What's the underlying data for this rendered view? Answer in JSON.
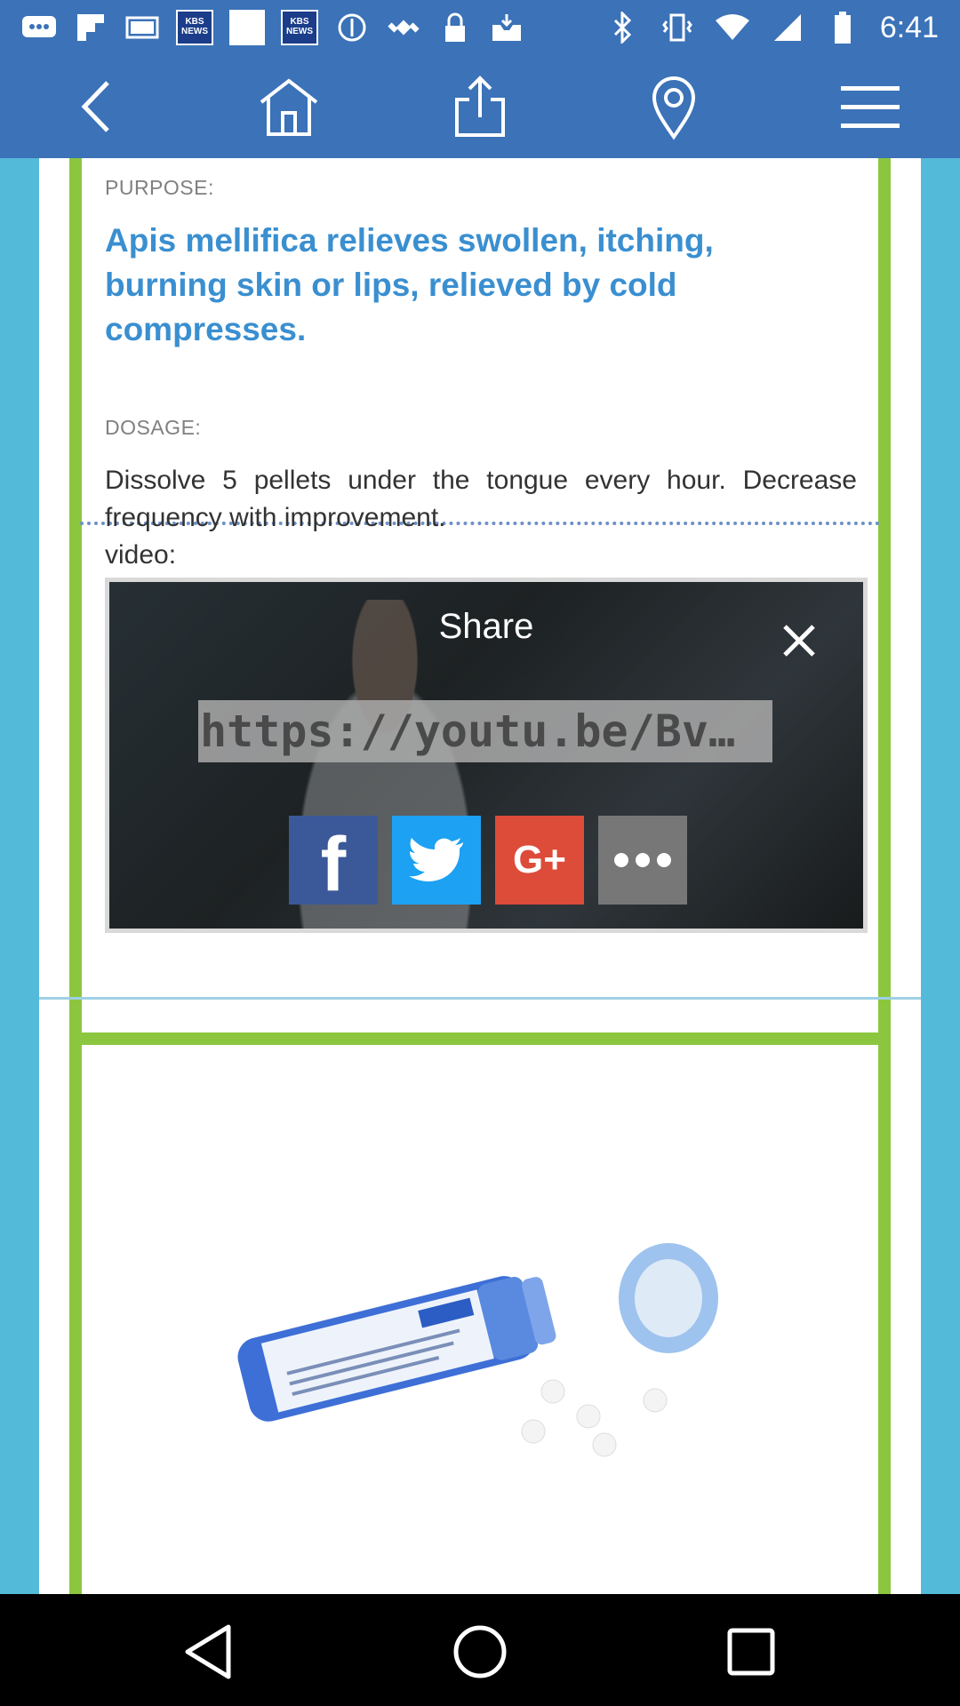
{
  "status_bar": {
    "time": "6:41",
    "kbs_badge": "KBS NEWS",
    "left_icons": [
      "kbs-news-icon",
      "kbs-news-icon",
      "white-square-icon",
      "kbs-news-icon",
      "white-square-icon",
      "do-not-disturb-icon",
      "fake-gps-icon",
      "lock-icon",
      "inbox-icon"
    ],
    "right_icons": [
      "bluetooth-icon",
      "vibrate-icon",
      "wifi-icon",
      "signal-icon",
      "battery-icon"
    ]
  },
  "toolbar": {
    "buttons": [
      "back-icon",
      "home-icon",
      "share-icon",
      "location-pin-icon",
      "menu-icon"
    ]
  },
  "content": {
    "purpose_label": "PURPOSE:",
    "purpose_text": "Apis mellifica relieves swollen, itching, burning skin or lips, relieved by cold compresses.",
    "dosage_label": "DOSAGE:",
    "dosage_text": "Dissolve 5 pellets under the tongue every hour. Decrease frequency with improvement.",
    "video_label": "video:"
  },
  "share_overlay": {
    "title": "Share",
    "url": "https://youtu.be/Bv…",
    "buttons": [
      {
        "name": "facebook",
        "glyph": "f",
        "color": "#3b5998"
      },
      {
        "name": "twitter",
        "color": "#1da1f2"
      },
      {
        "name": "google-plus",
        "glyph": "G+",
        "color": "#dd4b39"
      },
      {
        "name": "more",
        "color": "#777777"
      }
    ]
  },
  "colors": {
    "toolbar": "#3b72b8",
    "background": "#54bad9",
    "card_border": "#8cc63f",
    "purpose_text": "#3a8fd0"
  }
}
